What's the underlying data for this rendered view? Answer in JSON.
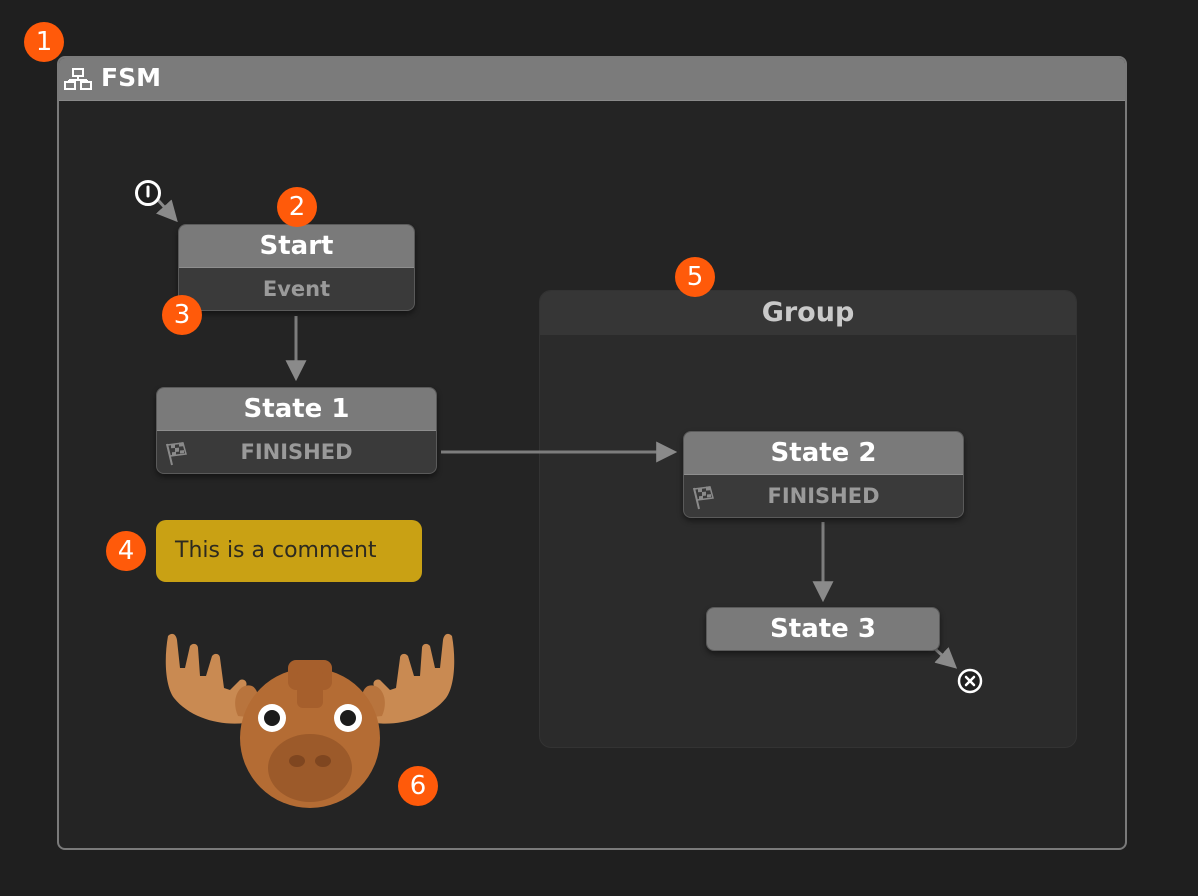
{
  "fsm": {
    "title": "FSM"
  },
  "nodes": {
    "start": {
      "title": "Start",
      "subtitle": "Event"
    },
    "state1": {
      "title": "State 1",
      "subtitle": "FINISHED"
    },
    "state2": {
      "title": "State 2",
      "subtitle": "FINISHED"
    },
    "state3": {
      "title": "State 3"
    }
  },
  "group": {
    "title": "Group"
  },
  "comment": {
    "text": "This is a comment"
  },
  "badges": [
    "1",
    "2",
    "3",
    "4",
    "5",
    "6"
  ],
  "icons": {
    "fsm": "hierarchy-icon",
    "entry": "entry-point-icon",
    "exit": "exit-point-icon",
    "finished": "checkered-flag-icon",
    "mascot": "moose-icon"
  },
  "colors": {
    "background": "#1f1f1f",
    "panel_header": "#7b7b7b",
    "node_header": "#7a7a7a",
    "badge": "#ff5a0a",
    "comment": "#c9a114",
    "group": "#2b2b2b"
  }
}
